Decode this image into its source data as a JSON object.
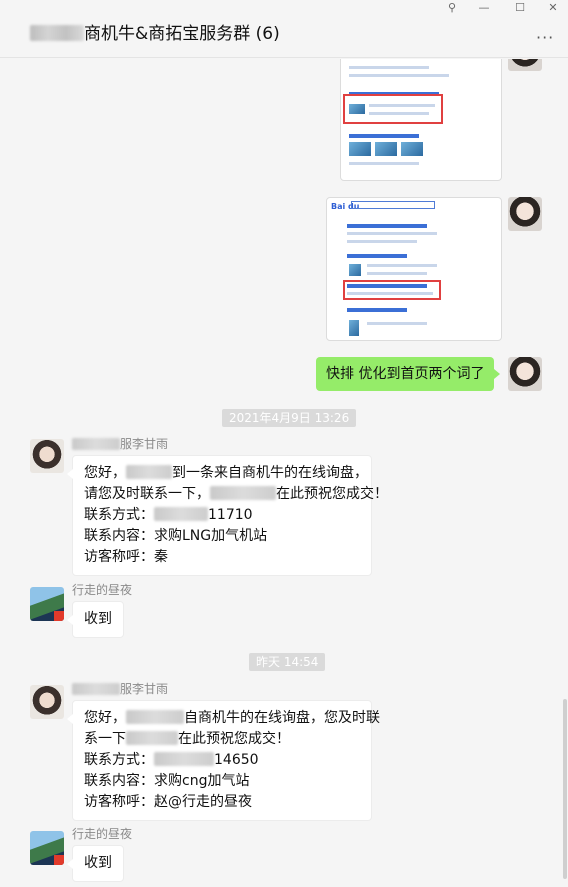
{
  "window": {
    "title": "商机牛&商拓宝服务群 (6)",
    "controls": {
      "pin": "⚲",
      "minimize": "—",
      "maximize": "☐",
      "close": "✕"
    },
    "more": "···"
  },
  "messages": {
    "self_text": "快排  优化到首页两个词了",
    "time1": "2021年4月9日 13:26",
    "msg1": {
      "sender": "服李甘雨",
      "line1_a": "您好，",
      "line1_b": "到一条来自商机牛的在线询盘，",
      "line2_a": "请您及时联系一下，",
      "line2_b": "在此预祝您成交！",
      "line3_a": "联系方式：",
      "line3_b": "11710",
      "line4": "联系内容：求购LNG加气机站",
      "line5": "访客称呼：秦"
    },
    "reply1": {
      "sender": "行走的昼夜",
      "text": "收到"
    },
    "time2": "昨天 14:54",
    "msg2": {
      "sender": "服李甘雨",
      "line1_a": "您好，",
      "line1_b": "自商机牛的在线询盘，您及时联",
      "line2_a": "系一下",
      "line2_b": "在此预祝您成交！",
      "line3_a": "联系方式：",
      "line3_b": "14650",
      "line4": "联系内容：求购cng加气站",
      "line5": "访客称呼：赵@行走的昼夜"
    },
    "reply2": {
      "sender": "行走的昼夜",
      "text": "收到"
    }
  },
  "icons": {
    "girl_avatar": "avatar-icon",
    "visitor_avatar": "avatar-icon",
    "screenshot_logo": "Bai du"
  }
}
